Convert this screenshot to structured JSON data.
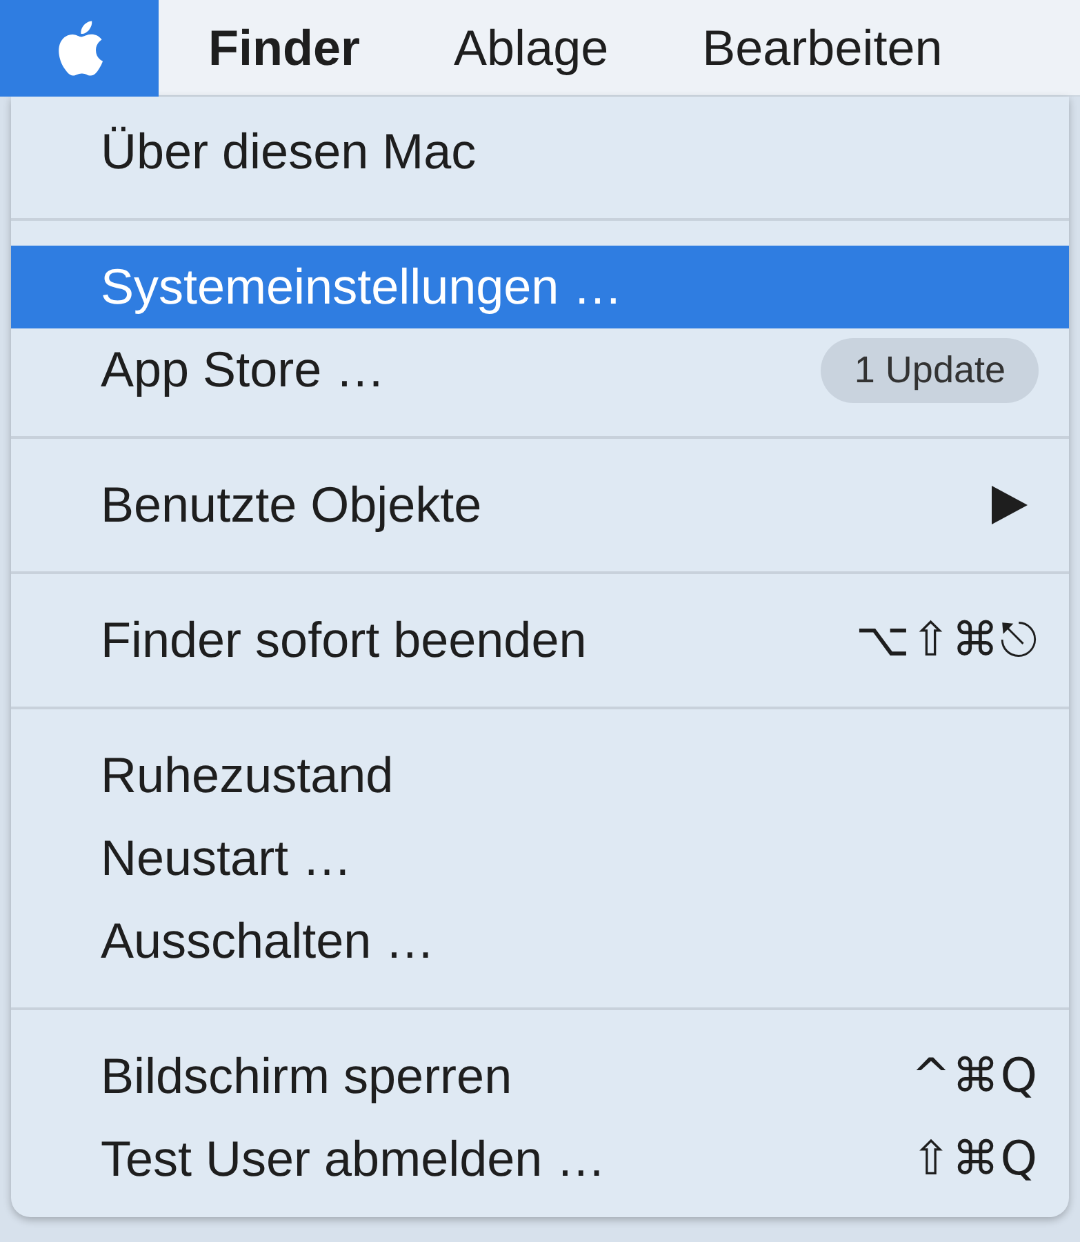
{
  "menu_bar": {
    "items": [
      {
        "label": "Finder",
        "selected": false
      },
      {
        "label": "Ablage",
        "selected": false
      },
      {
        "label": "Bearbeiten",
        "selected": false
      }
    ],
    "apple_selected": true
  },
  "menu": {
    "entries": [
      {
        "kind": "item",
        "label": "Über diesen Mac",
        "selected": false
      },
      {
        "kind": "separator"
      },
      {
        "kind": "item",
        "label": "Systemeinstellungen …",
        "selected": true
      },
      {
        "kind": "item",
        "label": "App Store …",
        "selected": false,
        "badge": "1 Update"
      },
      {
        "kind": "separator"
      },
      {
        "kind": "item",
        "label": "Benutzte Objekte",
        "selected": false,
        "submenu": true
      },
      {
        "kind": "separator"
      },
      {
        "kind": "item",
        "label": "Finder sofort beenden",
        "selected": false,
        "shortcut": "⌥⇧⌘⎋"
      },
      {
        "kind": "separator"
      },
      {
        "kind": "item",
        "label": "Ruhezustand",
        "selected": false
      },
      {
        "kind": "item",
        "label": "Neustart …",
        "selected": false
      },
      {
        "kind": "item",
        "label": "Ausschalten …",
        "selected": false
      },
      {
        "kind": "separator"
      },
      {
        "kind": "item",
        "label": "Bildschirm sperren",
        "selected": false,
        "shortcut": "^⌘Q"
      },
      {
        "kind": "item",
        "label": "Test User abmelden …",
        "selected": false,
        "shortcut": "⇧⌘Q"
      }
    ]
  }
}
